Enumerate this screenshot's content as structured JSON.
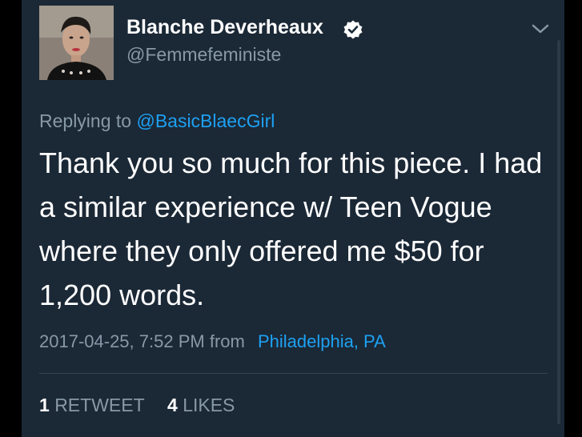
{
  "author": {
    "display_name": "Blanche Deverheaux",
    "handle": "@Femmefeministe",
    "verified_icon": "verified-badge-icon",
    "avatar_icon": "profile-photo"
  },
  "header": {
    "menu_icon": "chevron-down-icon"
  },
  "reply": {
    "prefix": "Replying to",
    "mention": "@BasicBlaecGirl"
  },
  "tweet": {
    "text": "Thank you so much for this piece. I had a similar experience w/ Teen Vogue where they only offered me $50 for 1,200 words."
  },
  "meta": {
    "timestamp": "2017-04-25, 7:52 PM",
    "from_label": "from",
    "location": "Philadelphia, PA"
  },
  "stats": {
    "retweets_count": "1",
    "retweets_label": "RETWEET",
    "likes_count": "4",
    "likes_label": "LIKES"
  },
  "colors": {
    "background": "#1b2836",
    "text": "#ffffff",
    "secondary": "#8899a6",
    "accent": "#1da1f2"
  }
}
